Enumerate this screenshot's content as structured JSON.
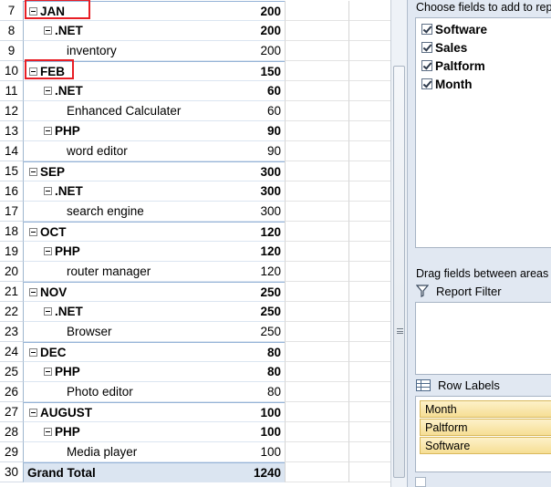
{
  "pivot": {
    "rows": [
      {
        "num": "7",
        "label": "JAN",
        "value": "200",
        "level": 0,
        "highlight": true
      },
      {
        "num": "8",
        "label": ".NET",
        "value": "200",
        "level": 1
      },
      {
        "num": "9",
        "label": "inventory",
        "value": "200",
        "level": 2
      },
      {
        "num": "10",
        "label": "FEB",
        "value": "150",
        "level": 0,
        "highlight": true
      },
      {
        "num": "11",
        "label": ".NET",
        "value": "60",
        "level": 1
      },
      {
        "num": "12",
        "label": "Enhanced Calculater",
        "value": "60",
        "level": 2
      },
      {
        "num": "13",
        "label": "PHP",
        "value": "90",
        "level": 1
      },
      {
        "num": "14",
        "label": "word editor",
        "value": "90",
        "level": 2
      },
      {
        "num": "15",
        "label": "SEP",
        "value": "300",
        "level": 0
      },
      {
        "num": "16",
        "label": ".NET",
        "value": "300",
        "level": 1
      },
      {
        "num": "17",
        "label": "search engine",
        "value": "300",
        "level": 2
      },
      {
        "num": "18",
        "label": "OCT",
        "value": "120",
        "level": 0
      },
      {
        "num": "19",
        "label": "PHP",
        "value": "120",
        "level": 1
      },
      {
        "num": "20",
        "label": "router manager",
        "value": "120",
        "level": 2
      },
      {
        "num": "21",
        "label": "NOV",
        "value": "250",
        "level": 0
      },
      {
        "num": "22",
        "label": ".NET",
        "value": "250",
        "level": 1
      },
      {
        "num": "23",
        "label": "Browser",
        "value": "250",
        "level": 2
      },
      {
        "num": "24",
        "label": "DEC",
        "value": "80",
        "level": 0
      },
      {
        "num": "25",
        "label": "PHP",
        "value": "80",
        "level": 1
      },
      {
        "num": "26",
        "label": "Photo editor",
        "value": "80",
        "level": 2
      },
      {
        "num": "27",
        "label": "AUGUST",
        "value": "100",
        "level": 0
      },
      {
        "num": "28",
        "label": "PHP",
        "value": "100",
        "level": 1
      },
      {
        "num": "29",
        "label": "Media player",
        "value": "100",
        "level": 2
      },
      {
        "num": "30",
        "label": "Grand Total",
        "value": "1240",
        "level": -1
      }
    ]
  },
  "field_list": {
    "choose_label": "Choose fields to add to rep",
    "fields": [
      {
        "label": "Software",
        "checked": true
      },
      {
        "label": "Sales",
        "checked": true
      },
      {
        "label": "Paltform",
        "checked": true
      },
      {
        "label": "Month",
        "checked": true
      }
    ],
    "drag_label": "Drag fields between areas",
    "report_filter": "Report Filter",
    "row_labels": "Row Labels",
    "row_fields": [
      "Month",
      "Paltform",
      "Software"
    ]
  },
  "colors": {
    "highlight": "#e81e25",
    "pivot_header_line": "#95b3d7",
    "grand_total_fill": "#dbe5f1",
    "field_pill": "#f6de94",
    "panel_bg": "#e1e8f2"
  },
  "icons": {
    "collapse": "collapse-minus-icon",
    "checkbox": "checkbox-checked-icon",
    "filter": "filter-funnel-icon",
    "row_labels": "row-labels-grid-icon",
    "scroll_grip": "scroll-grip-icon"
  }
}
